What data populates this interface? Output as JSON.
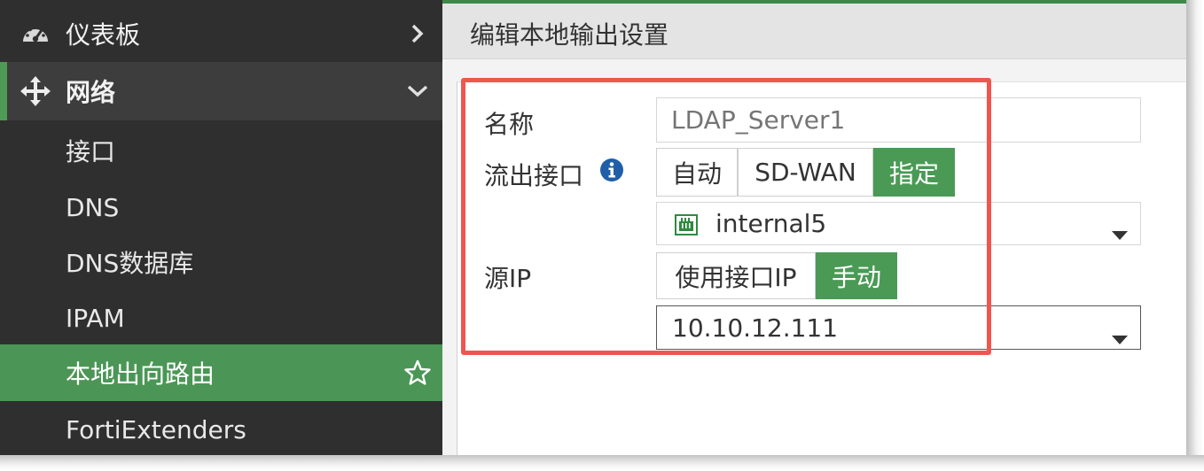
{
  "sidebar": {
    "items": [
      {
        "label": "仪表板",
        "icon": "dashboard-icon",
        "chevron": "chevron-right-icon"
      },
      {
        "label": "网络",
        "icon": "arrows-move-icon",
        "chevron": "chevron-down-icon"
      },
      {
        "label": "接口"
      },
      {
        "label": "DNS"
      },
      {
        "label": "DNS数据库"
      },
      {
        "label": "IPAM"
      },
      {
        "label": "本地出向路由",
        "active": true,
        "favorite_icon": "star-icon"
      },
      {
        "label": "FortiExtenders"
      }
    ]
  },
  "header": {
    "title": "编辑本地输出设置"
  },
  "form": {
    "name": {
      "label": "名称",
      "placeholder": "LDAP_Server1"
    },
    "outgoing_interface": {
      "label": "流出接口",
      "info_icon": "info-icon",
      "options": [
        "自动",
        "SD-WAN",
        "指定"
      ],
      "selected": "指定",
      "interface_value": "internal5",
      "interface_icon": "port-icon"
    },
    "source_ip": {
      "label": "源IP",
      "options": [
        "使用接口IP",
        "手动"
      ],
      "selected": "手动",
      "value": "10.10.12.111"
    }
  },
  "colors": {
    "accent_green": "#4a9a55",
    "highlight_red": "#f0564f",
    "sidebar_bg": "#2f2f2f"
  }
}
